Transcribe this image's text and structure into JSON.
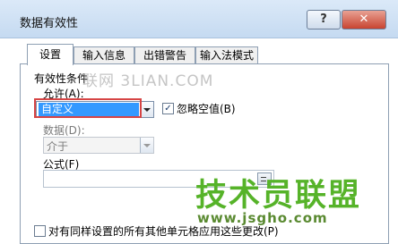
{
  "window": {
    "title": "数据有效性",
    "help_label": "?",
    "close_label": "✕"
  },
  "tabs": [
    {
      "label": "设置",
      "active": true
    },
    {
      "label": "输入信息",
      "active": false
    },
    {
      "label": "出错警告",
      "active": false
    },
    {
      "label": "输入法模式",
      "active": false
    }
  ],
  "settings": {
    "section_title": "有效性条件",
    "allow_label": "允许(A):",
    "allow_value": "自定义",
    "ignore_blank_label": "忽略空值(B)",
    "ignore_blank_checked": true,
    "data_label": "数据(D):",
    "data_value": "介于",
    "formula_label": "公式(F)",
    "formula_value": "",
    "apply_all_label": "对有同样设置的所有其他单元格应用这些更改(P)",
    "apply_all_checked": false
  },
  "watermarks": {
    "top": "联网 3LIAN.COM",
    "brand": "技术员联盟",
    "url": "www.jsgho.com"
  },
  "colors": {
    "selection": "#3399ff",
    "highlight_box": "#d64545",
    "brand_green": "#56b329"
  }
}
